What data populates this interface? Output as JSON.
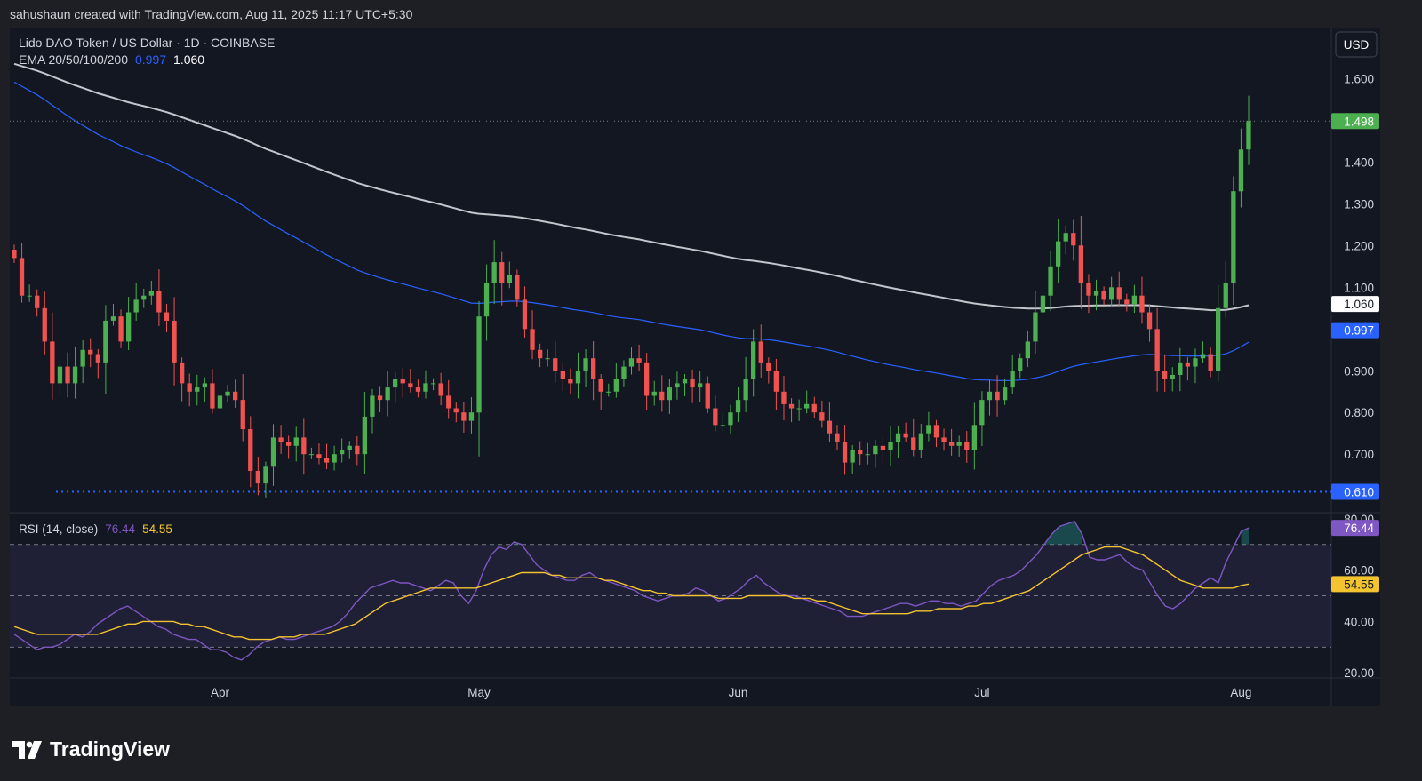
{
  "header": {
    "attribution": "sahushaun created with TradingView.com, Aug 11, 2025 11:17 UTC+5:30"
  },
  "brand": {
    "name": "TradingView"
  },
  "currency_button": "USD",
  "colors": {
    "up": "#4caf50",
    "down": "#ef5350",
    "ema200": "#c3c6cc",
    "ema100": "#2962ff",
    "rsi": "#7e57c2",
    "rsi_ma": "#f4c430",
    "support": "#2962ff",
    "background": "#131722",
    "frame": "#1e1f24"
  },
  "chart_data": [
    {
      "type": "candlestick",
      "title": "Lido DAO Token / US Dollar · 1D · COINBASE",
      "indicator_label": "EMA 20/50/100/200",
      "indicator_values": [
        "0.997",
        "1.060"
      ],
      "x_tick_labels": [
        "Apr",
        "May",
        "Jun",
        "Jul",
        "Aug"
      ],
      "y_tick_labels": [
        "1.600",
        "1.400",
        "1.300",
        "1.200",
        "1.100",
        "0.900",
        "0.800",
        "0.700"
      ],
      "ylim": [
        0.56,
        1.72
      ],
      "price_tags": [
        {
          "value": 1.498,
          "label": "1.498",
          "color": "#4caf50"
        },
        {
          "value": 1.06,
          "label": "1.060",
          "color": "#ffffff"
        },
        {
          "value": 0.997,
          "label": "0.997",
          "color": "#2962ff"
        },
        {
          "value": 0.61,
          "label": "0.610",
          "color": "#2962ff"
        }
      ],
      "support_level": 0.61,
      "last_price": 1.498,
      "closes": [
        1.17,
        1.08,
        1.08,
        1.05,
        0.97,
        0.87,
        0.91,
        0.87,
        0.91,
        0.95,
        0.94,
        0.92,
        1.02,
        1.03,
        0.97,
        1.04,
        1.07,
        1.08,
        1.09,
        1.04,
        1.02,
        0.92,
        0.87,
        0.85,
        0.86,
        0.87,
        0.81,
        0.84,
        0.85,
        0.83,
        0.76,
        0.66,
        0.63,
        0.67,
        0.74,
        0.73,
        0.72,
        0.74,
        0.7,
        0.7,
        0.69,
        0.68,
        0.7,
        0.71,
        0.72,
        0.7,
        0.79,
        0.84,
        0.83,
        0.86,
        0.88,
        0.87,
        0.86,
        0.85,
        0.87,
        0.87,
        0.84,
        0.81,
        0.8,
        0.78,
        0.8,
        1.03,
        1.11,
        1.16,
        1.11,
        1.13,
        1.07,
        1.0,
        0.95,
        0.93,
        0.93,
        0.9,
        0.88,
        0.87,
        0.9,
        0.93,
        0.88,
        0.85,
        0.85,
        0.88,
        0.91,
        0.93,
        0.92,
        0.84,
        0.85,
        0.83,
        0.86,
        0.87,
        0.88,
        0.86,
        0.87,
        0.81,
        0.77,
        0.77,
        0.8,
        0.83,
        0.88,
        0.97,
        0.92,
        0.9,
        0.85,
        0.82,
        0.81,
        0.81,
        0.82,
        0.8,
        0.78,
        0.75,
        0.73,
        0.68,
        0.71,
        0.7,
        0.7,
        0.72,
        0.71,
        0.73,
        0.75,
        0.74,
        0.71,
        0.75,
        0.77,
        0.74,
        0.73,
        0.72,
        0.73,
        0.71,
        0.77,
        0.83,
        0.85,
        0.83,
        0.86,
        0.9,
        0.93,
        0.97,
        1.04,
        1.08,
        1.15,
        1.21,
        1.23,
        1.2,
        1.11,
        1.08,
        1.09,
        1.07,
        1.1,
        1.07,
        1.06,
        1.08,
        1.04,
        1.0,
        0.9,
        0.88,
        0.89,
        0.92,
        0.91,
        0.93,
        0.94,
        0.9,
        1.05,
        1.11,
        1.33,
        1.43,
        1.498
      ],
      "axis_unit": "USD"
    },
    {
      "type": "line",
      "title": "RSI (14, close)",
      "values_label": [
        "76.44",
        "54.55"
      ],
      "y_tick_labels": [
        "80.00",
        "60.00",
        "40.00",
        "20.00"
      ],
      "ylim": [
        18,
        82
      ],
      "bands": [
        70,
        50,
        30
      ],
      "series": [
        {
          "name": "RSI",
          "last": 76.44,
          "color": "#7e57c2",
          "values": [
            35,
            33,
            31,
            29,
            30,
            30,
            31,
            33,
            35,
            34,
            36,
            39,
            41,
            43,
            45,
            46,
            44,
            42,
            40,
            38,
            37,
            35,
            34,
            33,
            33,
            31,
            29,
            29,
            28,
            26,
            25,
            27,
            30,
            32,
            33,
            34,
            33,
            33,
            34,
            35,
            36,
            37,
            38,
            40,
            43,
            47,
            50,
            53,
            54,
            55,
            56,
            55,
            55,
            54,
            53,
            52,
            54,
            56,
            55,
            50,
            47,
            52,
            60,
            66,
            69,
            68,
            71,
            70,
            66,
            62,
            60,
            58,
            57,
            56,
            56,
            58,
            59,
            57,
            56,
            55,
            54,
            53,
            52,
            50,
            49,
            48,
            49,
            50,
            50,
            51,
            53,
            52,
            50,
            48,
            49,
            51,
            53,
            56,
            58,
            55,
            53,
            51,
            50,
            50,
            49,
            48,
            47,
            46,
            45,
            44,
            42,
            42,
            42,
            43,
            44,
            45,
            46,
            47,
            47,
            46,
            47,
            48,
            48,
            47,
            47,
            46,
            47,
            48,
            51,
            54,
            56,
            57,
            58,
            60,
            63,
            66,
            70,
            74,
            77,
            78,
            79,
            74,
            65,
            64,
            64,
            65,
            66,
            63,
            61,
            60,
            55,
            50,
            46,
            45,
            47,
            50,
            53,
            55,
            57,
            55,
            63,
            69,
            75,
            76.44
          ]
        },
        {
          "name": "RSI MA",
          "last": 54.55,
          "color": "#f4c430",
          "values": [
            38,
            37,
            36,
            35,
            35,
            35,
            35,
            35,
            35,
            35,
            35,
            35,
            36,
            37,
            38,
            39,
            39,
            40,
            40,
            40,
            40,
            40,
            39,
            39,
            38,
            38,
            37,
            36,
            35,
            34,
            34,
            33,
            33,
            33,
            33,
            34,
            34,
            34,
            35,
            35,
            35,
            35,
            36,
            37,
            38,
            39,
            41,
            43,
            45,
            47,
            48,
            49,
            50,
            51,
            52,
            53,
            53,
            53,
            53,
            53,
            53,
            53,
            54,
            55,
            56,
            57,
            58,
            59,
            59,
            59,
            59,
            58,
            58,
            57,
            57,
            57,
            57,
            57,
            56,
            56,
            55,
            54,
            53,
            52,
            52,
            51,
            51,
            50,
            50,
            50,
            50,
            50,
            50,
            49,
            49,
            49,
            49,
            50,
            50,
            50,
            50,
            50,
            50,
            49,
            49,
            49,
            48,
            48,
            47,
            46,
            45,
            44,
            43,
            43,
            43,
            43,
            43,
            43,
            43,
            44,
            44,
            44,
            45,
            45,
            45,
            45,
            46,
            46,
            47,
            47,
            48,
            49,
            50,
            51,
            52,
            54,
            56,
            58,
            60,
            62,
            64,
            66,
            67,
            68,
            69,
            69,
            69,
            68,
            67,
            66,
            64,
            62,
            60,
            58,
            56,
            55,
            54,
            53,
            53,
            53,
            53,
            53,
            54,
            54.55
          ]
        }
      ],
      "area_label": "RSI"
    }
  ]
}
